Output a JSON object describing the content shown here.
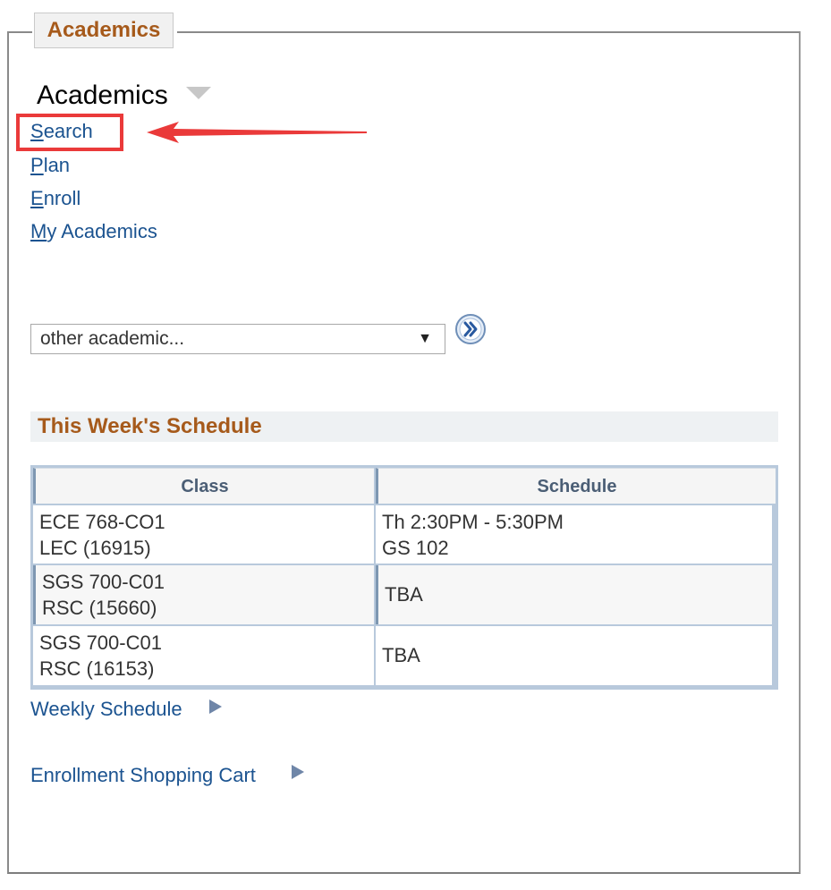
{
  "panel": {
    "tab_title": "Academics"
  },
  "section": {
    "title": "Academics"
  },
  "nav": [
    {
      "access_key": "S",
      "rest": "earch",
      "name": "nav-link-search"
    },
    {
      "access_key": "P",
      "rest": "lan",
      "name": "nav-link-plan"
    },
    {
      "access_key": "E",
      "rest": "nroll",
      "name": "nav-link-enroll"
    },
    {
      "access_key": "M",
      "rest": "y Academics",
      "name": "nav-link-my-academics"
    }
  ],
  "other_select": {
    "value": "other academic..."
  },
  "schedule": {
    "title": "This Week's Schedule",
    "columns": [
      "Class",
      "Schedule"
    ],
    "rows": [
      {
        "class_line1": "ECE 768-CO1",
        "class_line2": "LEC (16915)",
        "sched_line1": "Th 2:30PM - 5:30PM",
        "sched_line2": "GS 102"
      },
      {
        "class_line1": "SGS 700-C01",
        "class_line2": "RSC (15660)",
        "sched_line1": "TBA",
        "sched_line2": ""
      },
      {
        "class_line1": "SGS 700-C01",
        "class_line2": "RSC (16153)",
        "sched_line1": "TBA",
        "sched_line2": ""
      }
    ]
  },
  "links": {
    "weekly_schedule": "Weekly Schedule",
    "shopping_cart": "Enrollment Shopping Cart"
  },
  "colors": {
    "accent_title": "#a65a1b",
    "link": "#1b5390",
    "highlight": "#ea3a3a",
    "grid_border": "#b8c9dc"
  }
}
